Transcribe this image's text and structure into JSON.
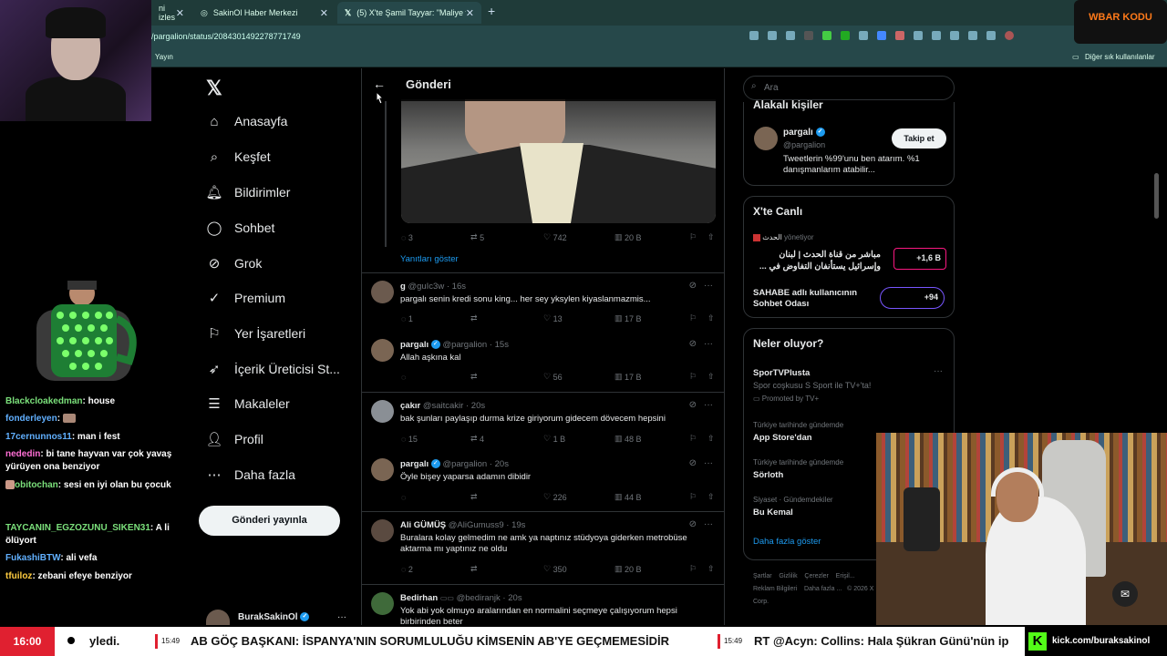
{
  "browser": {
    "tabs": [
      {
        "label": "ni izles",
        "active": false
      },
      {
        "label": "SakinOl Haber Merkezi",
        "active": false
      },
      {
        "label": "(5) X'te Şamil Tayyar: \"Maliye ve H",
        "active": true
      }
    ],
    "url": "/pargalion/status/2084301492278771749",
    "bookmark_left": "Yayın",
    "bookmark_right": "Diğer sık kullanılanlar"
  },
  "brand_badge": "WBAR KODU",
  "nav": {
    "items": [
      {
        "label": "Anasayfa",
        "icon": "home-icon"
      },
      {
        "label": "Keşfet",
        "icon": "search-icon"
      },
      {
        "label": "Bildirimler",
        "icon": "bell-icon"
      },
      {
        "label": "Sohbet",
        "icon": "chat-icon"
      },
      {
        "label": "Grok",
        "icon": "grok-icon"
      },
      {
        "label": "Premium",
        "icon": "premium-icon"
      },
      {
        "label": "Yer İşaretleri",
        "icon": "bookmark-icon"
      },
      {
        "label": "İçerik Üreticisi St...",
        "icon": "rocket-icon"
      },
      {
        "label": "Makaleler",
        "icon": "article-icon"
      },
      {
        "label": "Profil",
        "icon": "user-icon"
      },
      {
        "label": "Daha fazla",
        "icon": "more-circle-icon"
      }
    ],
    "post_button": "Gönderi yayınla",
    "account": "BurakSakinOl"
  },
  "center": {
    "title": "Gönderi",
    "main_stats": {
      "replies": "3",
      "reposts": "5",
      "likes": "742",
      "views": "20 B"
    },
    "show_replies": "Yanıtları göster",
    "posts": [
      {
        "name": "g",
        "handle": "@guIc3w",
        "time": "16s",
        "verified": false,
        "text": "pargalı senin kredi sonu king... her sey yksylen kiyaslanmazmis...",
        "replies": "1",
        "reposts": "",
        "likes": "13",
        "views": "17 B"
      },
      {
        "name": "pargalı",
        "handle": "@pargalion",
        "time": "15s",
        "verified": true,
        "text": "Allah aşkına kal",
        "replies": "",
        "reposts": "",
        "likes": "56",
        "views": "17 B"
      },
      {
        "name": "çakır",
        "handle": "@saitcakir",
        "time": "20s",
        "verified": false,
        "text": "bak şunları paylaşıp durma krize giriyorum gidecem dövecem hepsini",
        "replies": "15",
        "reposts": "4",
        "likes": "1 B",
        "views": "48 B"
      },
      {
        "name": "pargalı",
        "handle": "@pargalion",
        "time": "20s",
        "verified": true,
        "text": "Öyle bişey yaparsa adamın dibidir",
        "replies": "",
        "reposts": "",
        "likes": "226",
        "views": "44 B"
      },
      {
        "name": "Ali GÜMÜŞ",
        "handle": "@AliGumuss9",
        "time": "19s",
        "verified": false,
        "text": "Buralara kolay gelmedim ne amk ya naptınız stüdyoya giderken metrobüse aktarma mı yaptınız ne oldu",
        "replies": "2",
        "reposts": "",
        "likes": "350",
        "views": "20 B"
      },
      {
        "name": "Bedirhan",
        "handle": "@bediranjk",
        "time": "20s",
        "verified": false,
        "text": "Yok abi yok olmuyo aralarından en normalini seçmeye çalışıyorum hepsi birbirinden beter",
        "replies": "",
        "reposts": "",
        "likes": "",
        "views": ""
      }
    ]
  },
  "right": {
    "search_placeholder": "Ara",
    "related": {
      "title": "Alakalı kişiler",
      "name": "pargalı",
      "handle": "@pargalion",
      "follow": "Takip et",
      "bio": "Tweetlerin %99'unu ben atarım. %1 danışmanlarım atabilir..."
    },
    "live": {
      "title": "X'te Canlı",
      "host1": "الحدث",
      "host1_status": "yönetiyor",
      "item1_text": "مباشر من قناة الحدث | لبنان وإسرائيل يستأنفان التفاوض في ...",
      "item1_count": "+1,6 B",
      "item2_text": "SAHABE adlı kullanıcının Sohbet Odası",
      "item2_count": "+94"
    },
    "trends": {
      "title": "Neler oluyor?",
      "items": [
        {
          "name": "SporTVPlusta",
          "desc": "Spor coşkusu S Sport ile TV+'ta!",
          "meta": "Promoted by TV+"
        },
        {
          "meta": "Türkiye tarihinde gündemde",
          "name": "App Store'dan"
        },
        {
          "meta": "Türkiye tarihinde gündemde",
          "name": "Sörloth"
        },
        {
          "meta": "Siyaset · Gündemdekiler",
          "name": "Bu Kemal"
        }
      ],
      "more": "Daha fazla göster"
    },
    "footer": [
      "Şartlar",
      "Gizlilik",
      "Çerezler",
      "Erişil...",
      "Reklam Bilgileri",
      "Daha fazla ...",
      "© 2026 X Corp."
    ]
  },
  "chat": [
    {
      "user": "Blackcloakedman",
      "color": "#7be07b",
      "msg": "house"
    },
    {
      "user": "fonderleyen",
      "color": "#61b0ff",
      "msg": ""
    },
    {
      "user": "17cernunnos11",
      "color": "#61b0ff",
      "msg": "man i fest"
    },
    {
      "user": "nededin",
      "color": "#ff6fd5",
      "msg": "bi tane hayvan var çok yavaş yürüyen ona benziyor"
    },
    {
      "user": "obitochan",
      "color": "#7be07b",
      "msg": "sesi en iyi olan bu çocuk"
    },
    {
      "user": "TAYCANIN_EGZOZUNU_SIKEN31",
      "color": "#7be07b",
      "msg": "A li ölüyort"
    },
    {
      "user": "FukashiBTW",
      "color": "#61b0ff",
      "msg": "ali vefa"
    },
    {
      "user": "tfuiloz",
      "color": "#ffcc40",
      "msg": "zebani efeye benziyor"
    }
  ],
  "ticker": {
    "time": "16:00",
    "text1": "yledi.",
    "stamp1": "15:49",
    "text2": "AB GÖÇ BAŞKANI: İSPANYA'NIN SORUMLULUĞU KİMSENİN AB'YE GEÇMEMESİDİR",
    "stamp2": "15:49",
    "text3": "RT @Acyn: Collins: Hala Şükran Günü'nün ip",
    "kick": "kick.com/buraksakinol"
  }
}
